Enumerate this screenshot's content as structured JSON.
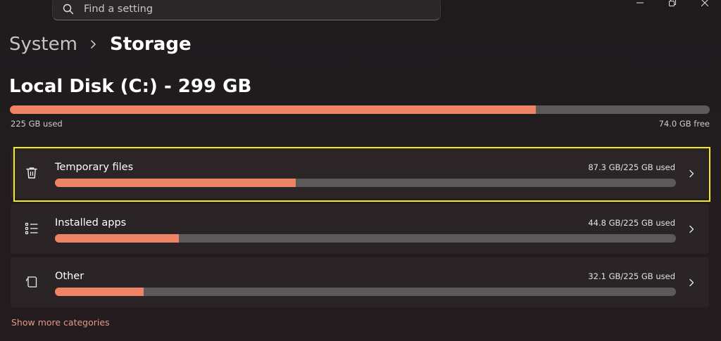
{
  "search": {
    "placeholder": "Find a setting"
  },
  "breadcrumb": {
    "parent": "System",
    "current": "Storage"
  },
  "disk": {
    "title": "Local Disk (C:) - 299 GB",
    "used_label": "225 GB used",
    "free_label": "74.0 GB free",
    "used_fraction": 0.752
  },
  "categories": [
    {
      "label": "Temporary files",
      "usage": "87.3 GB/225 GB used",
      "icon": "trash-icon",
      "fraction": 0.388
    },
    {
      "label": "Installed apps",
      "usage": "44.8 GB/225 GB used",
      "icon": "app-list-icon",
      "fraction": 0.199
    },
    {
      "label": "Other",
      "usage": "32.1 GB/225 GB used",
      "icon": "document-icon",
      "fraction": 0.143
    }
  ],
  "show_more": "Show more categories",
  "colors": {
    "accent": "#ee8366",
    "highlight": "#f5ec1a",
    "track": "#5d595a"
  }
}
